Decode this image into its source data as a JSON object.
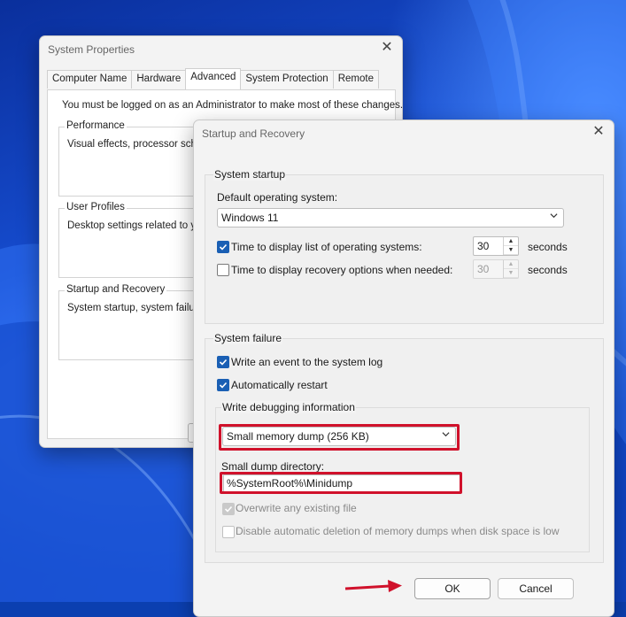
{
  "system_properties": {
    "title": "System Properties",
    "tabs": [
      "Computer Name",
      "Hardware",
      "Advanced",
      "System Protection",
      "Remote"
    ],
    "active_tab": "Advanced",
    "admin_note": "You must be logged on as an Administrator to make most of these changes.",
    "groups": [
      {
        "title": "Performance",
        "desc": "Visual effects, processor sched"
      },
      {
        "title": "User Profiles",
        "desc": "Desktop settings related to you"
      },
      {
        "title": "Startup and Recovery",
        "desc": "System startup, system failure,"
      }
    ]
  },
  "startup_recovery": {
    "title": "Startup and Recovery",
    "system_startup": {
      "title": "System startup",
      "default_os_label": "Default operating system:",
      "default_os_value": "Windows 11",
      "time_list_label": "Time to display list of operating systems:",
      "time_list_checked": true,
      "time_list_value": "30",
      "time_recovery_label": "Time to display recovery options when needed:",
      "time_recovery_checked": false,
      "time_recovery_value": "30",
      "seconds": "seconds"
    },
    "system_failure": {
      "title": "System failure",
      "write_event_label": "Write an event to the system log",
      "write_event_checked": true,
      "auto_restart_label": "Automatically restart",
      "auto_restart_checked": true,
      "debug_title": "Write debugging information",
      "debug_value": "Small memory dump (256 KB)",
      "dump_dir_label": "Small dump directory:",
      "dump_dir_value": "%SystemRoot%\\Minidump",
      "overwrite_label": "Overwrite any existing file",
      "overwrite_checked": true,
      "disable_auto_delete_label": "Disable automatic deletion of memory dumps when disk space is low",
      "disable_auto_delete_checked": false
    },
    "ok_label": "OK",
    "cancel_label": "Cancel"
  },
  "colors": {
    "highlight": "#d0112b",
    "checkbox": "#1a5fb4"
  }
}
